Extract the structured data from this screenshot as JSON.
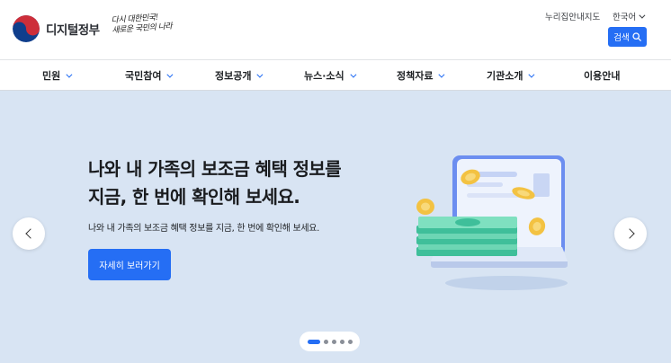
{
  "brand": {
    "name": "디지털정부",
    "slogan_line1": "다시 대한민국!",
    "slogan_line2": "새로운 국민의 나라"
  },
  "utility": {
    "sitemap_label": "누리집안내지도",
    "language_label": "한국어",
    "search_label": "검색"
  },
  "nav": {
    "items": [
      {
        "label": "민원",
        "has_dropdown": true
      },
      {
        "label": "국민참여",
        "has_dropdown": true
      },
      {
        "label": "정보공개",
        "has_dropdown": true
      },
      {
        "label": "뉴스·소식",
        "has_dropdown": true
      },
      {
        "label": "정책자료",
        "has_dropdown": true
      },
      {
        "label": "기관소개",
        "has_dropdown": true
      },
      {
        "label": "이용안내",
        "has_dropdown": false
      }
    ]
  },
  "hero": {
    "title_line1": "나와 내 가족의 보조금 혜택 정보를",
    "title_line2": "지금, 한 번에 확인해 보세요.",
    "description": "나와 내 가족의 보조금 혜택 정보를 지금, 한 번에 확인해 보세요.",
    "cta_label": "자세히 보러가기",
    "slide_count": 5,
    "active_slide": 1,
    "illustration_icon": "laptop-money-icon"
  },
  "colors": {
    "primary": "#256ef4",
    "hero_bg": "#d8e4f3",
    "flag_red": "#cd2e3a",
    "flag_blue": "#0f3e8c"
  }
}
